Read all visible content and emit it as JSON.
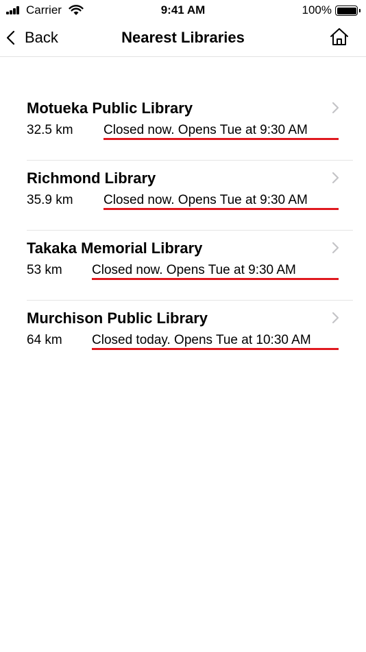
{
  "status_bar": {
    "carrier": "Carrier",
    "time": "9:41 AM",
    "battery": "100%"
  },
  "nav": {
    "back_label": "Back",
    "title": "Nearest Libraries"
  },
  "libraries": [
    {
      "name": "Motueka Public Library",
      "distance": "32.5 km",
      "status": "Closed now. Opens Tue at 9:30 AM"
    },
    {
      "name": "Richmond Library",
      "distance": "35.9 km",
      "status": "Closed now. Opens Tue at 9:30 AM"
    },
    {
      "name": "Takaka Memorial Library",
      "distance": "53 km",
      "status": "Closed now. Opens Tue at 9:30 AM"
    },
    {
      "name": "Murchison Public Library",
      "distance": "64 km",
      "status": "Closed today. Opens Tue at 10:30 AM"
    }
  ],
  "colors": {
    "underline": "#e0191f",
    "chevron": "#c4c4c7",
    "separator": "#e4e4e4"
  }
}
